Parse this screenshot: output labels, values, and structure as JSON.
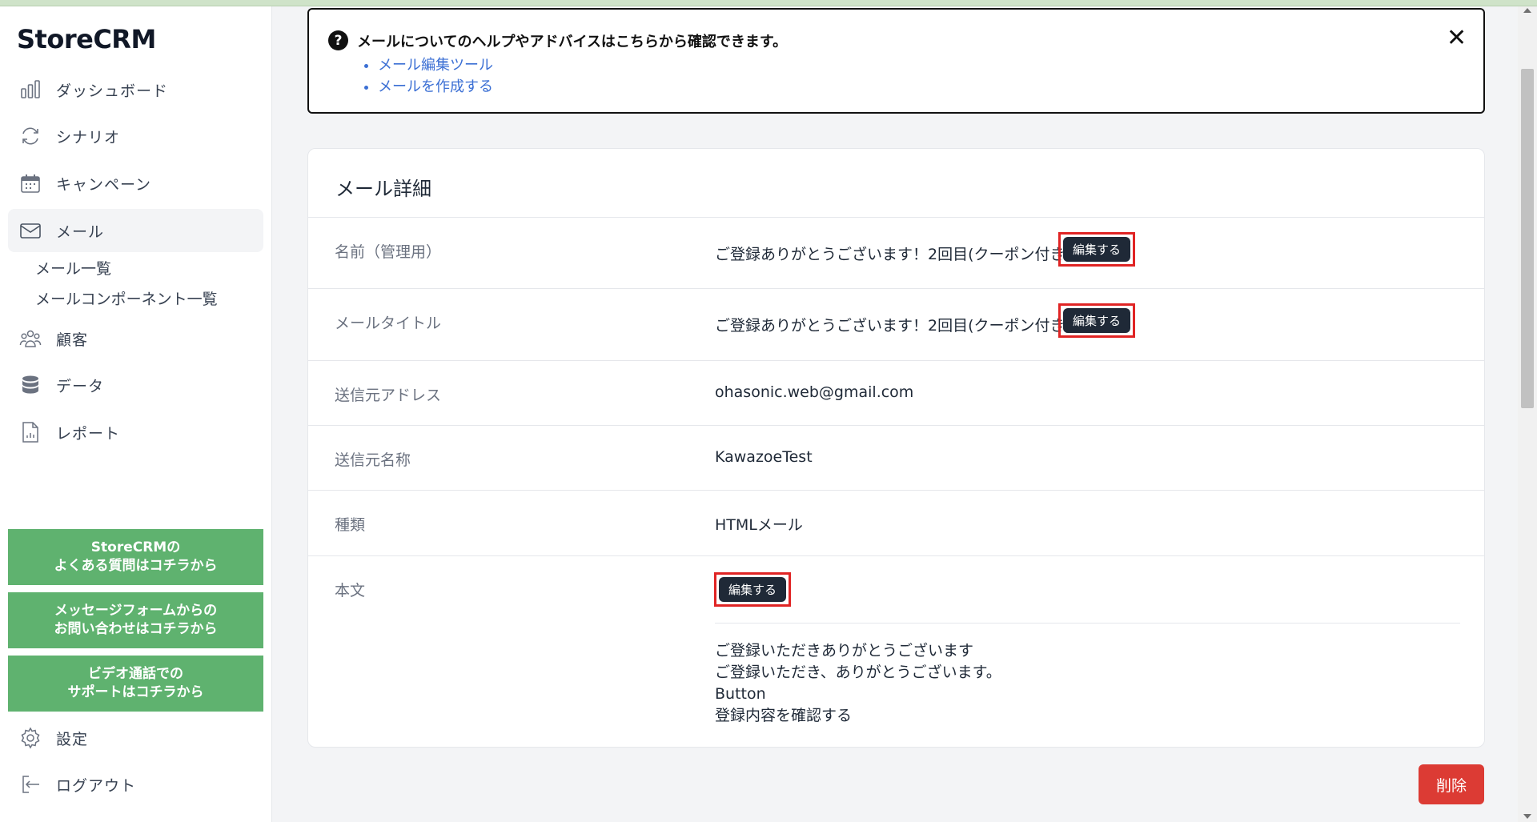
{
  "app": {
    "brand": "StoreCRM"
  },
  "sidebar": {
    "items": [
      {
        "label": "ダッシュボード",
        "icon": "bar-chart-icon"
      },
      {
        "label": "シナリオ",
        "icon": "refresh-icon"
      },
      {
        "label": "キャンペーン",
        "icon": "calendar-icon"
      },
      {
        "label": "メール",
        "icon": "envelope-icon"
      },
      {
        "label": "顧客",
        "icon": "users-icon"
      },
      {
        "label": "データ",
        "icon": "database-icon"
      },
      {
        "label": "レポート",
        "icon": "report-icon"
      }
    ],
    "mail_sub": [
      "メール一覧",
      "メールコンポーネント一覧"
    ],
    "help_buttons": [
      {
        "line1": "StoreCRMの",
        "line2": "よくある質問はコチラから"
      },
      {
        "line1": "メッセージフォームからの",
        "line2": "お問い合わせはコチラから"
      },
      {
        "line1": "ビデオ通話での",
        "line2": "サポートはコチラから"
      }
    ],
    "settings_label": "設定",
    "logout_label": "ログアウト"
  },
  "banner": {
    "icon": "question-icon",
    "title": "メールについてのヘルプやアドバイスはこちらから確認できます。",
    "links": [
      "メール編集ツール",
      "メールを作成する"
    ],
    "close": "✕"
  },
  "card": {
    "title": "メール詳細",
    "rows": [
      {
        "label": "名前（管理用）",
        "value": "ご登録ありがとうございます！2回目(クーポン付き)"
      },
      {
        "label": "メールタイトル",
        "value": "ご登録ありがとうございます！2回目(クーポン付き)"
      },
      {
        "label": "送信元アドレス",
        "value": "ohasonic.web@gmail.com"
      },
      {
        "label": "送信元名称",
        "value": "KawazoeTest"
      },
      {
        "label": "種類",
        "value": "HTMLメール"
      },
      {
        "label": "本文",
        "value": ""
      }
    ],
    "edit_label": "編集する",
    "body_lines": [
      "ご登録いただきありがとうございます",
      "ご登録いただき、ありがとうございます。",
      "Button",
      "登録内容を確認する"
    ]
  },
  "delete_label": "削除",
  "colors": {
    "accent_green": "#5fb26f",
    "danger": "#dc3b34",
    "button_dark": "#1f2937",
    "highlight_red": "#e02424",
    "link": "#3b6fd4"
  }
}
